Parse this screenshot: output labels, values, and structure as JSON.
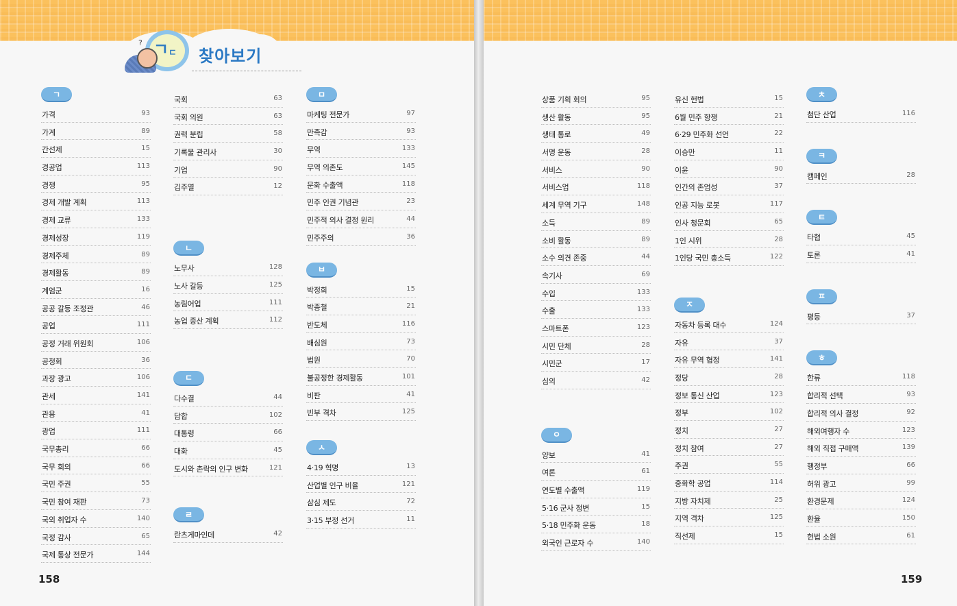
{
  "title": "찾아보기",
  "page_left": "158",
  "page_right": "159",
  "colors": {
    "band": "#fbc15d",
    "pill": "#7ab6e3",
    "title": "#2b79c4"
  },
  "sections": {
    "giyeok": {
      "label": "ㄱ",
      "entries": [
        {
          "t": "가격",
          "n": "93"
        },
        {
          "t": "가계",
          "n": "89"
        },
        {
          "t": "간선제",
          "n": "15"
        },
        {
          "t": "경공업",
          "n": "113"
        },
        {
          "t": "경쟁",
          "n": "95"
        },
        {
          "t": "경제 개발 계획",
          "n": "113"
        },
        {
          "t": "경제 교류",
          "n": "133"
        },
        {
          "t": "경제성장",
          "n": "119"
        },
        {
          "t": "경제주체",
          "n": "89"
        },
        {
          "t": "경제활동",
          "n": "89"
        },
        {
          "t": "계엄군",
          "n": "16"
        },
        {
          "t": "공공 갈등 조정관",
          "n": "46"
        },
        {
          "t": "공업",
          "n": "111"
        },
        {
          "t": "공정 거래 위원회",
          "n": "106"
        },
        {
          "t": "공청회",
          "n": "36"
        },
        {
          "t": "과장 광고",
          "n": "106"
        },
        {
          "t": "관세",
          "n": "141"
        },
        {
          "t": "관용",
          "n": "41"
        },
        {
          "t": "광업",
          "n": "111"
        },
        {
          "t": "국무총리",
          "n": "66"
        },
        {
          "t": "국무 회의",
          "n": "66"
        },
        {
          "t": "국민 주권",
          "n": "55"
        },
        {
          "t": "국민 참여 재판",
          "n": "73"
        },
        {
          "t": "국외 취업자 수",
          "n": "140"
        },
        {
          "t": "국정 감사",
          "n": "65"
        },
        {
          "t": "국제 통상 전문가",
          "n": "144"
        }
      ]
    },
    "giyeok_cont": {
      "entries": [
        {
          "t": "국회",
          "n": "63"
        },
        {
          "t": "국회 의원",
          "n": "63"
        },
        {
          "t": "권력 분립",
          "n": "58"
        },
        {
          "t": "기록물 관리사",
          "n": "30"
        },
        {
          "t": "기업",
          "n": "90"
        },
        {
          "t": "김주열",
          "n": "12"
        }
      ]
    },
    "nieun": {
      "label": "ㄴ",
      "entries": [
        {
          "t": "노무사",
          "n": "128"
        },
        {
          "t": "노사 갈등",
          "n": "125"
        },
        {
          "t": "농림어업",
          "n": "111"
        },
        {
          "t": "농업 증산 계획",
          "n": "112"
        }
      ]
    },
    "digeut": {
      "label": "ㄷ",
      "entries": [
        {
          "t": "다수결",
          "n": "44"
        },
        {
          "t": "담합",
          "n": "102"
        },
        {
          "t": "대통령",
          "n": "66"
        },
        {
          "t": "대화",
          "n": "45"
        },
        {
          "t": "도시와 촌락의 인구 변화",
          "n": "121"
        }
      ]
    },
    "rieul": {
      "label": "ㄹ",
      "entries": [
        {
          "t": "란츠게마인데",
          "n": "42"
        }
      ]
    },
    "mieum": {
      "label": "ㅁ",
      "entries": [
        {
          "t": "마케팅 전문가",
          "n": "97"
        },
        {
          "t": "만족감",
          "n": "93"
        },
        {
          "t": "무역",
          "n": "133"
        },
        {
          "t": "무역 의존도",
          "n": "145"
        },
        {
          "t": "문화 수출액",
          "n": "118"
        },
        {
          "t": "민주 인권 기념관",
          "n": "23"
        },
        {
          "t": "민주적 의사 결정 원리",
          "n": "44"
        },
        {
          "t": "민주주의",
          "n": "36"
        }
      ]
    },
    "bieup": {
      "label": "ㅂ",
      "entries": [
        {
          "t": "박정희",
          "n": "15"
        },
        {
          "t": "박종철",
          "n": "21"
        },
        {
          "t": "반도체",
          "n": "116"
        },
        {
          "t": "배심원",
          "n": "73"
        },
        {
          "t": "법원",
          "n": "70"
        },
        {
          "t": "불공정한 경제활동",
          "n": "101"
        },
        {
          "t": "비판",
          "n": "41"
        },
        {
          "t": "빈부 격차",
          "n": "125"
        }
      ]
    },
    "siot": {
      "label": "ㅅ",
      "entries": [
        {
          "t": "4·19 혁명",
          "n": "13"
        },
        {
          "t": "산업별 인구 비율",
          "n": "121"
        },
        {
          "t": "삼심 제도",
          "n": "72"
        },
        {
          "t": "3·15 부정 선거",
          "n": "11"
        }
      ]
    },
    "siot_cont": {
      "entries": [
        {
          "t": "상품 기획 회의",
          "n": "95"
        },
        {
          "t": "생산 활동",
          "n": "95"
        },
        {
          "t": "생태 통로",
          "n": "49"
        },
        {
          "t": "서명 운동",
          "n": "28"
        },
        {
          "t": "서비스",
          "n": "90"
        },
        {
          "t": "서비스업",
          "n": "118"
        },
        {
          "t": "세계 무역 기구",
          "n": "148"
        },
        {
          "t": "소득",
          "n": "89"
        },
        {
          "t": "소비 활동",
          "n": "89"
        },
        {
          "t": "소수 의견 존중",
          "n": "44"
        },
        {
          "t": "속기사",
          "n": "69"
        },
        {
          "t": "수입",
          "n": "133"
        },
        {
          "t": "수출",
          "n": "133"
        },
        {
          "t": "스마트폰",
          "n": "123"
        },
        {
          "t": "시민 단체",
          "n": "28"
        },
        {
          "t": "시민군",
          "n": "17"
        },
        {
          "t": "심의",
          "n": "42"
        }
      ]
    },
    "ieung": {
      "label": "ㅇ",
      "entries": [
        {
          "t": "양보",
          "n": "41"
        },
        {
          "t": "여론",
          "n": "61"
        },
        {
          "t": "연도별 수출액",
          "n": "119"
        },
        {
          "t": "5·16 군사 정변",
          "n": "15"
        },
        {
          "t": "5·18 민주화 운동",
          "n": "18"
        },
        {
          "t": "외국인 근로자 수",
          "n": "140"
        }
      ]
    },
    "ieung_cont": {
      "entries": [
        {
          "t": "유신 헌법",
          "n": "15"
        },
        {
          "t": "6월 민주 항쟁",
          "n": "21"
        },
        {
          "t": "6·29 민주화 선언",
          "n": "22"
        },
        {
          "t": "이승만",
          "n": "11"
        },
        {
          "t": "이윤",
          "n": "90"
        },
        {
          "t": "인간의 존엄성",
          "n": "37"
        },
        {
          "t": "인공 지능 로봇",
          "n": "117"
        },
        {
          "t": "인사 청문회",
          "n": "65"
        },
        {
          "t": "1인 시위",
          "n": "28"
        },
        {
          "t": "1인당 국민 총소득",
          "n": "122"
        }
      ]
    },
    "jieut": {
      "label": "ㅈ",
      "entries": [
        {
          "t": "자동차 등록 대수",
          "n": "124"
        },
        {
          "t": "자유",
          "n": "37"
        },
        {
          "t": "자유 무역 협정",
          "n": "141"
        },
        {
          "t": "정당",
          "n": "28"
        },
        {
          "t": "정보 통신 산업",
          "n": "123"
        },
        {
          "t": "정부",
          "n": "102"
        },
        {
          "t": "정치",
          "n": "27"
        },
        {
          "t": "정치 참여",
          "n": "27"
        },
        {
          "t": "주권",
          "n": "55"
        },
        {
          "t": "중화학 공업",
          "n": "114"
        },
        {
          "t": "지방 자치제",
          "n": "25"
        },
        {
          "t": "지역 격차",
          "n": "125"
        },
        {
          "t": "직선제",
          "n": "15"
        }
      ]
    },
    "chieut": {
      "label": "ㅊ",
      "entries": [
        {
          "t": "첨단 산업",
          "n": "116"
        }
      ]
    },
    "kieuk": {
      "label": "ㅋ",
      "entries": [
        {
          "t": "캠페인",
          "n": "28"
        }
      ]
    },
    "tieut": {
      "label": "ㅌ",
      "entries": [
        {
          "t": "타협",
          "n": "45"
        },
        {
          "t": "토론",
          "n": "41"
        }
      ]
    },
    "pieup": {
      "label": "ㅍ",
      "entries": [
        {
          "t": "평등",
          "n": "37"
        }
      ]
    },
    "hieut": {
      "label": "ㅎ",
      "entries": [
        {
          "t": "한류",
          "n": "118"
        },
        {
          "t": "합리적 선택",
          "n": "93"
        },
        {
          "t": "합리적 의사 결정",
          "n": "92"
        },
        {
          "t": "해외여행자 수",
          "n": "123"
        },
        {
          "t": "해외 직접 구매액",
          "n": "139"
        },
        {
          "t": "행정부",
          "n": "66"
        },
        {
          "t": "허위 광고",
          "n": "99"
        },
        {
          "t": "환경문제",
          "n": "124"
        },
        {
          "t": "환율",
          "n": "150"
        },
        {
          "t": "헌법 소원",
          "n": "61"
        }
      ]
    }
  }
}
